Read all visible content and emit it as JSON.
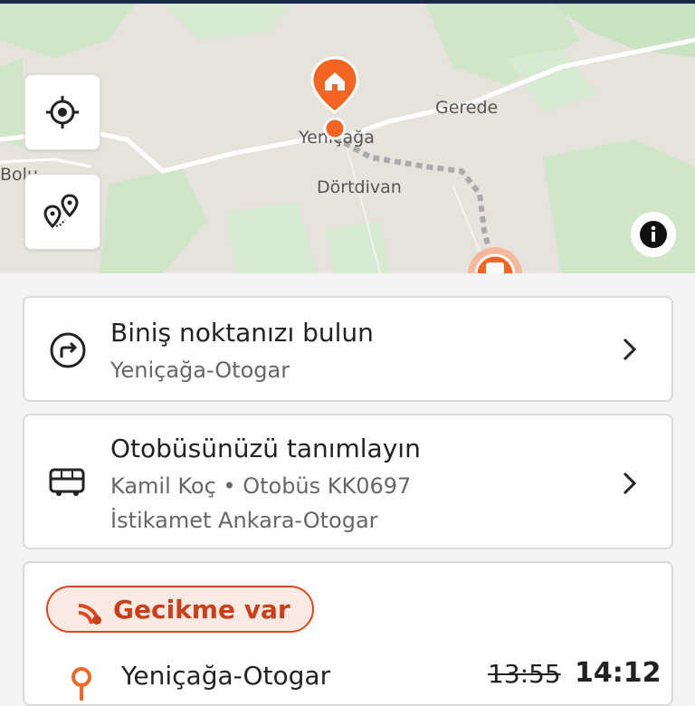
{
  "map": {
    "labels": {
      "bolu": "Bolu",
      "yenicaga": "Yeniçağa",
      "gerede": "Gerede",
      "dortdivan": "Dörtdivan"
    },
    "accent_color": "#f26522",
    "buttons": {
      "locate": "crosshair-icon",
      "route": "route-pins-icon",
      "info": "info-icon"
    }
  },
  "boarding_card": {
    "title": "Biniş noktanızı bulun",
    "subtitle": "Yeniçağa-Otogar"
  },
  "bus_card": {
    "title": "Otobüsünüzü tanımlayın",
    "line1": "Kamil Koç • Otobüs KK0697",
    "line2": "İstikamet Ankara-Otogar"
  },
  "status_card": {
    "badge": "Gecikme var",
    "badge_color": "#e0461e",
    "stop_name": "Yeniçağa-Otogar",
    "scheduled_time": "13:55",
    "expected_time": "14:12"
  }
}
